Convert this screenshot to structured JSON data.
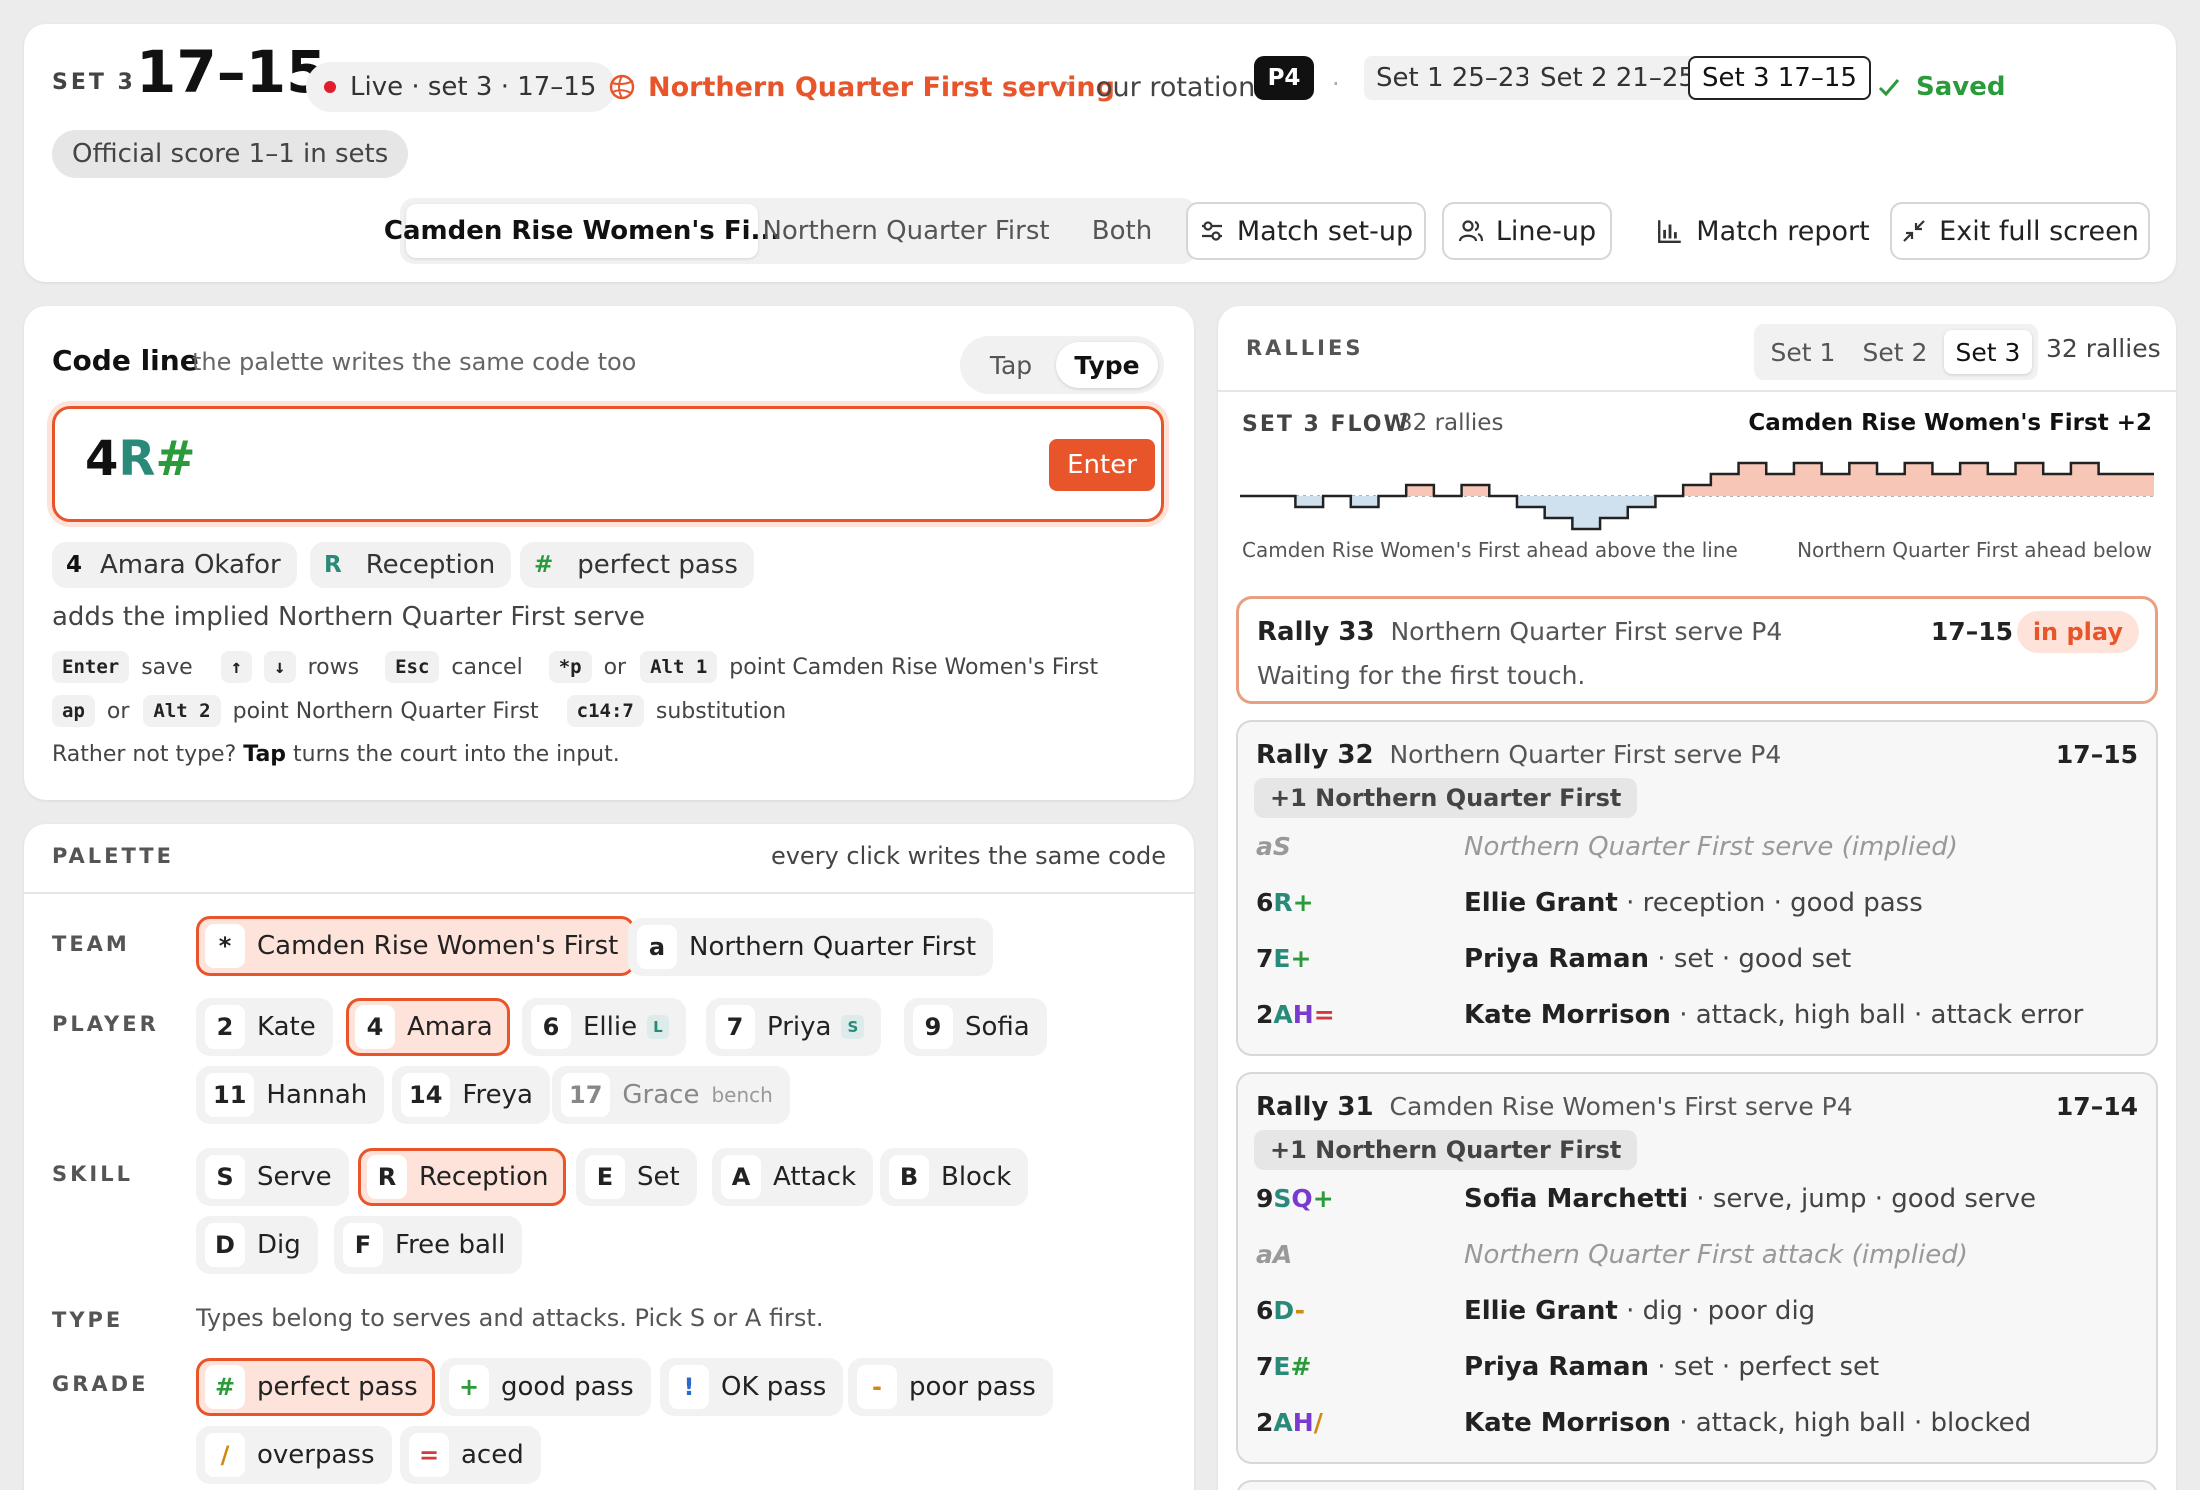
{
  "header": {
    "set_label": "SET 3",
    "score": "17–15",
    "live_badge": "Live · set 3 · 17–15",
    "serving": "Northern Quarter First serving",
    "rotation_label": "our rotation",
    "rotation": "P4",
    "set_scores": [
      "Set 1 25–23",
      "Set 2 21–25",
      "Set 3 17–15"
    ],
    "saved": "Saved",
    "official": "Official score 1–1 in sets",
    "team_tabs": [
      "Camden Rise Women's Fi...",
      "Northern Quarter First",
      "Both"
    ],
    "buttons": {
      "setup": "Match set-up",
      "lineup": "Line-up",
      "report": "Match report",
      "exit": "Exit full screen"
    }
  },
  "code_line": {
    "title": "Code line",
    "subtitle": "the palette writes the same code too",
    "modes": [
      "Tap",
      "Type"
    ],
    "input": {
      "p1": "4",
      "p2": "R",
      "p3": "#"
    },
    "enter": "Enter",
    "parse": [
      {
        "k": "4",
        "v": "Amara Okafor"
      },
      {
        "k": "R",
        "v": "Reception"
      },
      {
        "k": "#",
        "v": "perfect pass"
      }
    ],
    "implied": "adds the implied Northern Quarter First serve",
    "shortcuts1": {
      "k1": "Enter",
      "t1": "save",
      "k2": "↑",
      "k3": "↓",
      "t2": "rows",
      "k4": "Esc",
      "t3": "cancel",
      "k5": "*p",
      "t4": "or",
      "k6": "Alt 1",
      "t5": "point Camden Rise Women's First"
    },
    "shortcuts2": {
      "k1": "ap",
      "t1": "or",
      "k2": "Alt 2",
      "t2": "point Northern Quarter First",
      "k3": "c14:7",
      "t3": "substitution"
    },
    "tip_a": "Rather not type?",
    "tip_b": "Tap",
    "tip_c": "turns the court into the input."
  },
  "palette": {
    "title": "PALETTE",
    "note": "every click writes the same code",
    "labels": {
      "team": "TEAM",
      "player": "PLAYER",
      "skill": "SKILL",
      "type": "TYPE",
      "grade": "GRADE"
    },
    "teams": [
      {
        "k": "*",
        "v": "Camden Rise Women's First"
      },
      {
        "k": "a",
        "v": "Northern Quarter First"
      }
    ],
    "players": [
      {
        "k": "2",
        "v": "Kate"
      },
      {
        "k": "4",
        "v": "Amara"
      },
      {
        "k": "6",
        "v": "Ellie",
        "tag": "L"
      },
      {
        "k": "7",
        "v": "Priya",
        "tag": "S"
      },
      {
        "k": "9",
        "v": "Sofia"
      },
      {
        "k": "11",
        "v": "Hannah"
      },
      {
        "k": "14",
        "v": "Freya"
      },
      {
        "k": "17",
        "v": "Grace",
        "bench": "bench"
      }
    ],
    "skills": [
      {
        "k": "S",
        "v": "Serve"
      },
      {
        "k": "R",
        "v": "Reception"
      },
      {
        "k": "E",
        "v": "Set"
      },
      {
        "k": "A",
        "v": "Attack"
      },
      {
        "k": "B",
        "v": "Block"
      },
      {
        "k": "D",
        "v": "Dig"
      },
      {
        "k": "F",
        "v": "Free ball"
      }
    ],
    "type_note": "Types belong to serves and attacks. Pick S or A first.",
    "grades": [
      {
        "k": "#",
        "v": "perfect pass"
      },
      {
        "k": "+",
        "v": "good pass"
      },
      {
        "k": "!",
        "v": "OK pass"
      },
      {
        "k": "-",
        "v": "poor pass"
      },
      {
        "k": "/",
        "v": "overpass"
      },
      {
        "k": "=",
        "v": "aced"
      }
    ]
  },
  "rallies": {
    "title": "RALLIES",
    "tabs": [
      "Set 1",
      "Set 2",
      "Set 3"
    ],
    "count": "32 rallies",
    "flow_title": "SET 3 FLOW",
    "flow_count": "32 rallies",
    "flow_lead": "Camden Rise Women's First +2",
    "flow_above": "Camden Rise Women's First ahead above the line",
    "flow_below": "Northern Quarter First ahead below",
    "r33": {
      "num": "Rally 33",
      "meta": "Northern Quarter First serve   P4",
      "score": "17–15",
      "status": "in play",
      "waiting": "Waiting for the first touch."
    },
    "r32": {
      "num": "Rally 32",
      "meta": "Northern Quarter First serve   P4",
      "score": "17–15",
      "point": "+1 Northern Quarter First",
      "events": [
        {
          "code": "aS",
          "text": "Northern Quarter First serve (implied)"
        },
        {
          "code": "6R+",
          "name": "Ellie Grant",
          "text": " · reception · good pass"
        },
        {
          "code": "7E+",
          "name": "Priya Raman",
          "text": " · set · good set"
        },
        {
          "code": "2AH=",
          "name": "Kate Morrison",
          "text": " · attack, high ball · attack error"
        }
      ]
    },
    "r31": {
      "num": "Rally 31",
      "meta": "Camden Rise Women's First serve   P4",
      "score": "17–14",
      "point": "+1 Northern Quarter First",
      "events": [
        {
          "code": "9SQ+",
          "name": "Sofia Marchetti",
          "text": " · serve, jump · good serve"
        },
        {
          "code": "aA",
          "text": "Northern Quarter First attack (implied)"
        },
        {
          "code": "6D-",
          "name": "Ellie Grant",
          "text": " · dig · poor dig"
        },
        {
          "code": "7E#",
          "name": "Priya Raman",
          "text": " · set · perfect set"
        },
        {
          "code": "2AH/",
          "name": "Kate Morrison",
          "text": " · attack, high ball · blocked"
        }
      ]
    }
  },
  "chart_data": {
    "type": "line",
    "title": "SET 3 FLOW",
    "description_lead": "Camden Rise Women's First +2",
    "x": [
      0,
      1,
      2,
      3,
      4,
      5,
      6,
      7,
      8,
      9,
      10,
      11,
      12,
      13,
      14,
      15,
      16,
      17,
      18,
      19,
      20,
      21,
      22,
      23,
      24,
      25,
      26,
      27,
      28,
      29,
      30,
      31,
      32
    ],
    "series": [
      {
        "values": [
          0,
          0,
          -1,
          0,
          -1,
          0,
          1,
          0,
          1,
          0,
          -1,
          -2,
          -3,
          -2,
          -1,
          0,
          1,
          2,
          3,
          2,
          3,
          2,
          3,
          2,
          3,
          2,
          3,
          2,
          3,
          2,
          3,
          2,
          2
        ]
      }
    ],
    "ylim": [
      -3,
      3
    ]
  },
  "colors": {
    "accent": "#e8552a",
    "live": "#e11d2e",
    "saved": "#2a9a3a",
    "teal": "#2a8a7a",
    "flow_up": "#f7c6b6",
    "flow_down": "#cfe0ee"
  }
}
